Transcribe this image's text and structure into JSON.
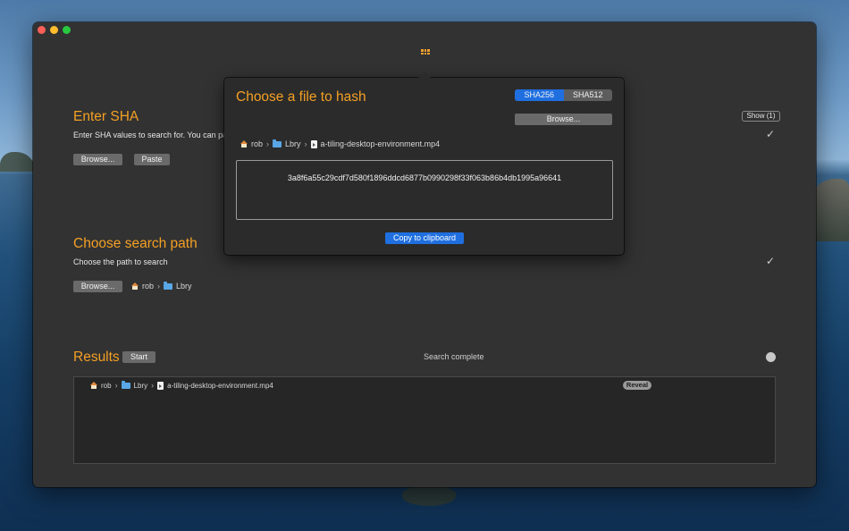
{
  "enter_sha": {
    "title": "Enter SHA",
    "description": "Enter SHA values to search for. You can pa",
    "browse_label": "Browse...",
    "paste_label": "Paste",
    "show_label": "Show (1)",
    "status_icon": "checkmark-icon"
  },
  "search_path": {
    "title": "Choose search path",
    "description": "Choose the path to search",
    "browse_label": "Browse...",
    "path": [
      "rob",
      "Lbry"
    ],
    "status_icon": "checkmark-icon"
  },
  "results": {
    "title": "Results",
    "start_label": "Start",
    "status_text": "Search complete",
    "items": [
      {
        "path": [
          "rob",
          "Lbry",
          "a-tiling-desktop-environment.mp4"
        ],
        "reveal_label": "Reveal"
      }
    ]
  },
  "popover": {
    "title": "Choose a file to hash",
    "algorithms": [
      "SHA256",
      "SHA512"
    ],
    "selected_algorithm": "SHA256",
    "browse_label": "Browse...",
    "path": [
      "rob",
      "Lbry",
      "a-tiling-desktop-environment.mp4"
    ],
    "hash_value": "3a8f6a55c29cdf7d580f1896ddcd6877b0990298f33f063b86b4db1995a96641",
    "copy_label": "Copy to clipboard"
  },
  "colors": {
    "accent_orange": "#f5a024",
    "accent_blue": "#1f6fe0",
    "window_bg": "#323232"
  },
  "chev": "›"
}
